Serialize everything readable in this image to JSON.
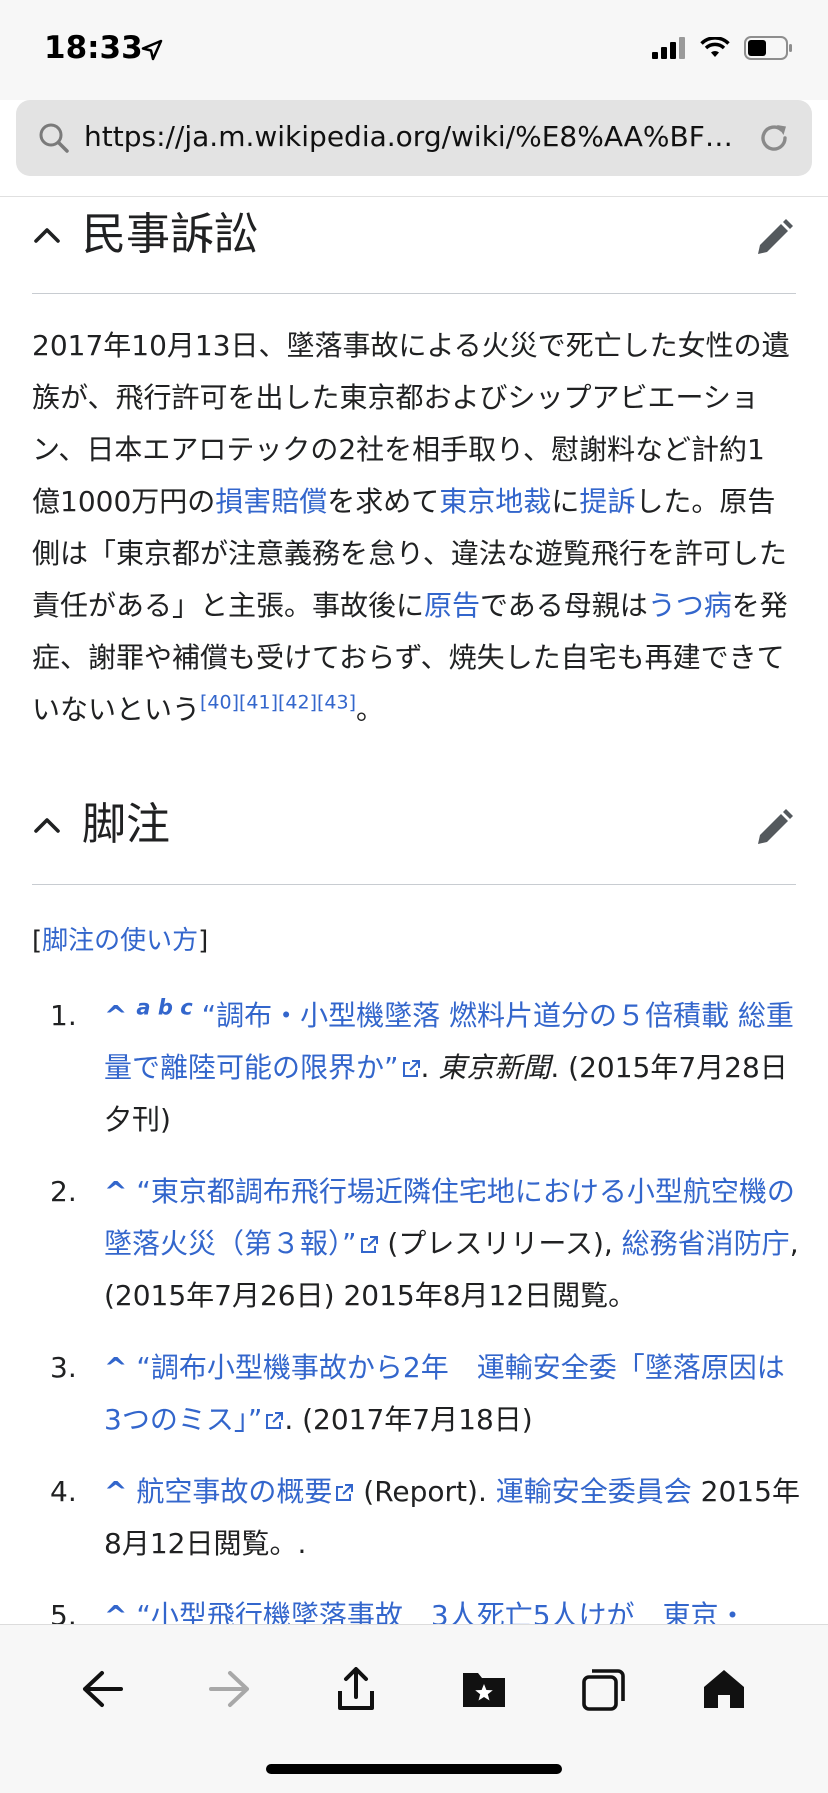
{
  "status": {
    "time": "18:33"
  },
  "browser": {
    "url": "https://ja.m.wikipedia.org/wiki/%E8%AA%BF…"
  },
  "section1": {
    "title": "民事訴訟",
    "t1": "2017年10月13日、墜落事故による火災で死亡した女性の遺族が、飛行許可を出した東京都およびシップアビエーション、日本エアロテックの2社を相手取り、慰謝料など計約1億1000万円の",
    "l1": "損害賠償",
    "t2": "を求めて",
    "l2": "東京地裁",
    "t3": "に",
    "l3": "提訴",
    "t4": "した。原告側は「東京都が注意義務を怠り、違法な遊覧飛行を許可した責任がある」と主張。事故後に",
    "l4": "原告",
    "t5": "である母親は",
    "l5": "うつ病",
    "t6": "を発症、謝罪や補償も受けておらず、焼失した自宅も再建できていないという",
    "sup": "[40][41][42][43]",
    "t7": "。"
  },
  "section2": {
    "title": "脚注",
    "howto_open": "[",
    "howto_link": "脚注の使い方",
    "howto_close": "]"
  },
  "refs": [
    {
      "num": "1.",
      "caret": "^",
      "abc": "a b c",
      "link": "“調布・小型機墜落 燃料片道分の５倍積載 総重量で離陸可能の限界か”",
      "sep": ". ",
      "italic": "東京新聞",
      "rest": ". (2015年7月28日夕刊)"
    },
    {
      "num": "2.",
      "caret": "^",
      "link": "“東京都調布飛行場近隣住宅地における小型航空機の墜落火災（第３報）”",
      "rest1": " (プレスリリース), ",
      "link2": "総務省消防庁",
      "rest2": ", (2015年7月26日) 2015年8月12日閲覧。"
    },
    {
      "num": "3.",
      "caret": "^",
      "link": "“調布小型機事故から2年　運輸安全委「墜落原因は3つのミス」”",
      "rest": ". (2017年7月18日)"
    },
    {
      "num": "4.",
      "caret": "^",
      "link": "航空事故の概要",
      "rest1": " (Report). ",
      "link2": "運輸安全委員会",
      "rest2": " 2015年8月12日閲覧。."
    },
    {
      "num": "5.",
      "caret": "^",
      "link": "“小型飛行機墜落事故　3人死亡5人けが　東京・"
    }
  ],
  "toolbar": {
    "icons": [
      "back-icon",
      "forward-icon",
      "share-icon",
      "bookmarks-icon",
      "tabs-icon",
      "home-icon"
    ]
  }
}
